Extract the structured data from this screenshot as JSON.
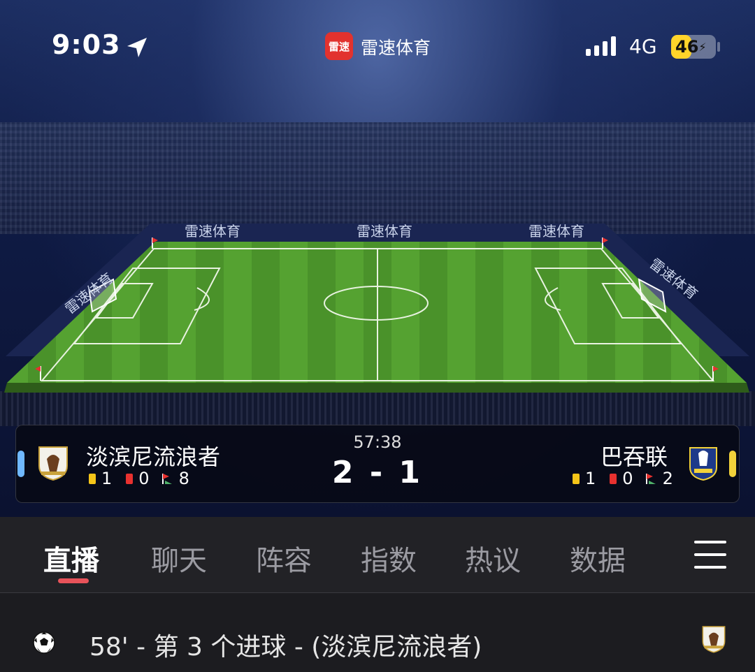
{
  "status_bar": {
    "time": "9:03",
    "network": "4G",
    "battery": "46",
    "battery_level": 0.46
  },
  "app": {
    "badge_text": "雷速",
    "name": "雷速体育"
  },
  "field": {
    "ad_board": [
      "雷速体育",
      "雷速体育",
      "雷速体育",
      "雷速体育",
      "雷速体育"
    ]
  },
  "match": {
    "time": "57:38",
    "score": "2 - 1",
    "home": {
      "name": "淡滨尼流浪者",
      "yellow": "1",
      "red": "0",
      "corners": "8",
      "accent": "#6fb8ff"
    },
    "away": {
      "name": "巴吞联",
      "yellow": "1",
      "red": "0",
      "corners": "2",
      "accent": "#f2d23a"
    }
  },
  "tabs": [
    {
      "label": "直播",
      "active": true
    },
    {
      "label": "聊天"
    },
    {
      "label": "阵容"
    },
    {
      "label": "指数"
    },
    {
      "label": "热议"
    },
    {
      "label": "数据"
    }
  ],
  "events": [
    {
      "text": "58' - 第 3 个进球 - (淡滨尼流浪者)",
      "icon": "soccer-ball-icon"
    }
  ],
  "colors": {
    "yellow_card": "#f5c518",
    "red_card": "#e8312f",
    "tab_accent": "#e8535a",
    "pitch": "#4f9a2e"
  }
}
